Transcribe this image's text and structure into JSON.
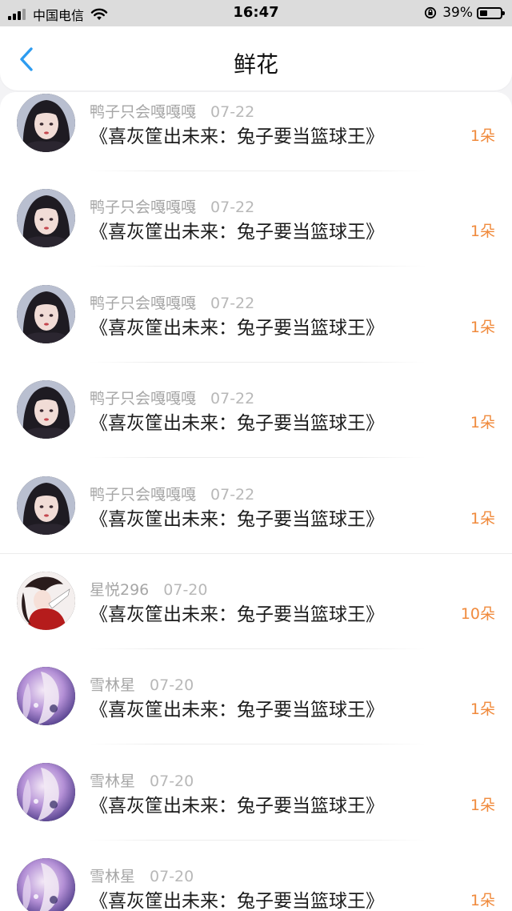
{
  "status_bar": {
    "carrier": "中国电信",
    "time": "16:47",
    "battery": "39%",
    "battery_level": 0.39
  },
  "header": {
    "title": "鲜花"
  },
  "items": [
    {
      "user": "鸭子只会嘎嘎嘎",
      "date": "07-22",
      "book": "《喜灰筐出未来：兔子要当篮球王》",
      "count": "1朵",
      "avatar": "dark-hair-avatar-icon"
    },
    {
      "user": "鸭子只会嘎嘎嘎",
      "date": "07-22",
      "book": "《喜灰筐出未来：兔子要当篮球王》",
      "count": "1朵",
      "avatar": "dark-hair-avatar-icon"
    },
    {
      "user": "鸭子只会嘎嘎嘎",
      "date": "07-22",
      "book": "《喜灰筐出未来：兔子要当篮球王》",
      "count": "1朵",
      "avatar": "dark-hair-avatar-icon"
    },
    {
      "user": "鸭子只会嘎嘎嘎",
      "date": "07-22",
      "book": "《喜灰筐出未来：兔子要当篮球王》",
      "count": "1朵",
      "avatar": "dark-hair-avatar-icon"
    },
    {
      "user": "鸭子只会嘎嘎嘎",
      "date": "07-22",
      "book": "《喜灰筐出未来：兔子要当篮球王》",
      "count": "1朵",
      "avatar": "dark-hair-avatar-icon"
    },
    {
      "user": "星悦296",
      "date": "07-20",
      "book": "《喜灰筐出未来：兔子要当篮球王》",
      "count": "10朵",
      "avatar": "red-anime-avatar-icon"
    },
    {
      "user": "雪林星",
      "date": "07-20",
      "book": "《喜灰筐出未来：兔子要当篮球王》",
      "count": "1朵",
      "avatar": "purple-anime-avatar-icon"
    },
    {
      "user": "雪林星",
      "date": "07-20",
      "book": "《喜灰筐出未来：兔子要当篮球王》",
      "count": "1朵",
      "avatar": "purple-anime-avatar-icon"
    },
    {
      "user": "雪林星",
      "date": "07-20",
      "book": "《喜灰筐出未来：兔子要当篮球王》",
      "count": "1朵",
      "avatar": "purple-anime-avatar-icon"
    }
  ],
  "colors": {
    "accent": "#2d9cf0",
    "count": "#f08a3c"
  }
}
